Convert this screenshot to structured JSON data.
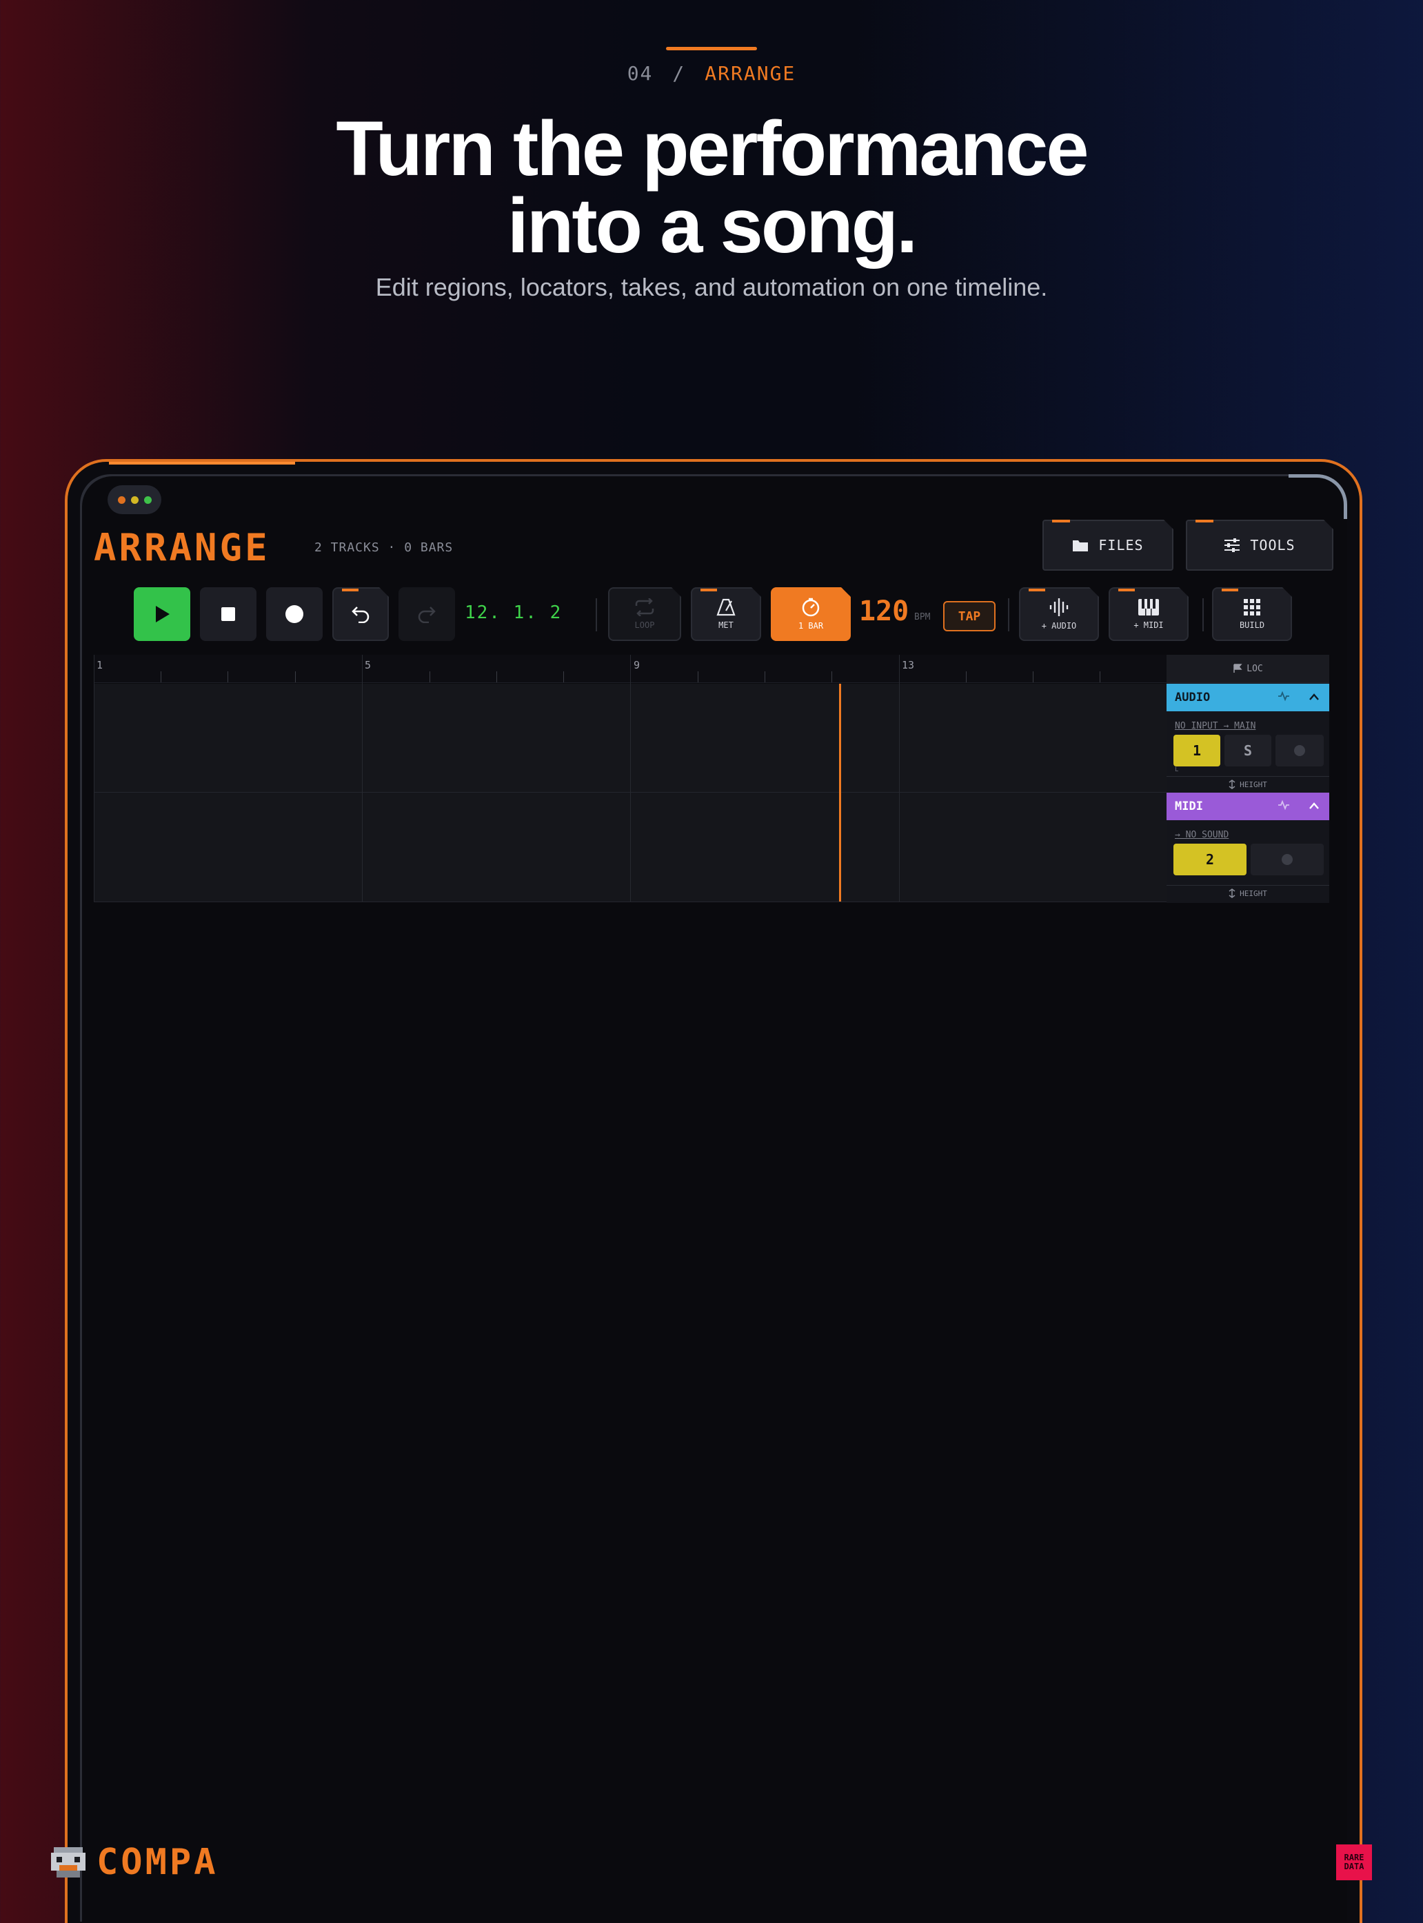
{
  "hero": {
    "section_number": "04",
    "separator": "/",
    "section_name": "ARRANGE",
    "headline_line1": "Turn the performance",
    "headline_line2": "into a song.",
    "subheadline": "Edit regions, locators, takes, and automation on one timeline."
  },
  "app": {
    "title": "ARRANGE",
    "meta": "2 TRACKS · 0 BARS",
    "top_buttons": {
      "files": "FILES",
      "tools": "TOOLS"
    },
    "transport": {
      "position": "12. 1. 2",
      "loop_label": "LOOP",
      "met_label": "MET",
      "countin_label": "1 BAR",
      "bpm_value": "120",
      "bpm_unit": "BPM",
      "tap_label": "TAP",
      "add_audio_label": "+ AUDIO",
      "add_midi_label": "+ MIDI",
      "build_label": "BUILD"
    },
    "ruler": {
      "bars": [
        "1",
        "5",
        "9",
        "13"
      ]
    },
    "inspector": {
      "loc_label": "LOC",
      "tracks": [
        {
          "name": "AUDIO",
          "color": "#3aaee0",
          "route": "NO INPUT → MAIN",
          "number": "1",
          "solo": "S",
          "height_label": "HEIGHT",
          "meter_label": "L"
        },
        {
          "name": "MIDI",
          "color": "#9a5ad8",
          "route": "→ NO SOUND",
          "number": "2",
          "height_label": "HEIGHT"
        }
      ]
    }
  },
  "brand": {
    "logo_text": "COMPA",
    "badge_line1": "RARE",
    "badge_line2": "DATA"
  },
  "colors": {
    "accent": "#f07a22",
    "play": "#33c24a",
    "position": "#3fd24a",
    "track_number": "#d4c224"
  }
}
